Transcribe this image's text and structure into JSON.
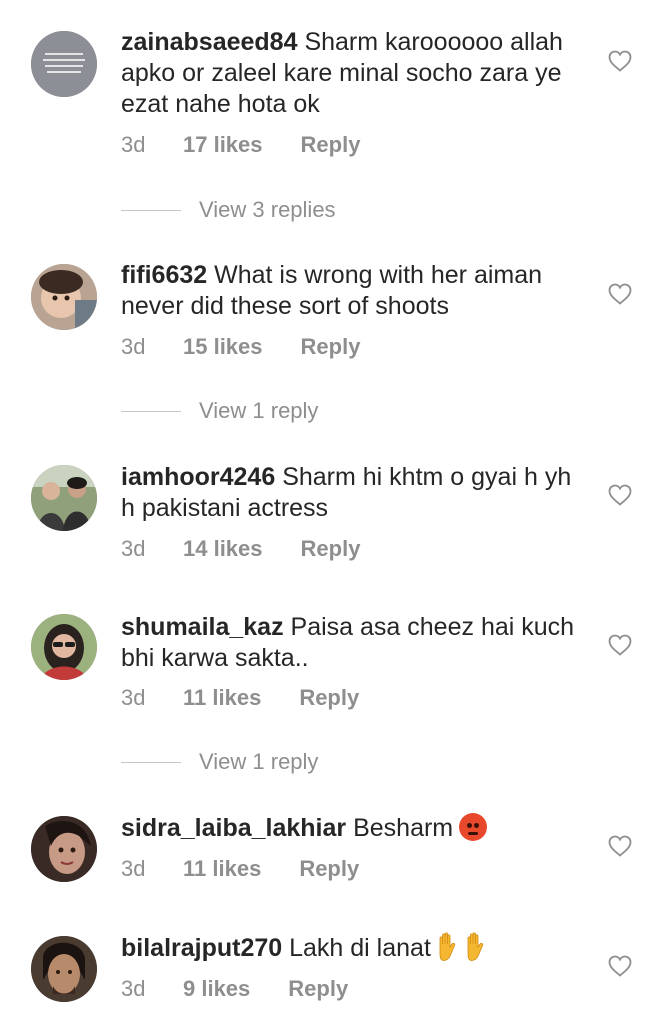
{
  "comments": [
    {
      "username": "zainabsaeed84",
      "text": "Sharm karoooooo allah apko or zaleel kare minal socho zara ye ezat nahe hota ok",
      "time": "3d",
      "likes": "17 likes",
      "reply": "Reply",
      "view_replies": "View 3 replies"
    },
    {
      "username": "fifi6632",
      "text": "What is wrong with her aiman never did these sort of shoots",
      "time": "3d",
      "likes": "15 likes",
      "reply": "Reply",
      "view_replies": "View 1 reply"
    },
    {
      "username": "iamhoor4246",
      "text": "Sharm hi khtm o gyai h yh h pakistani actress",
      "time": "3d",
      "likes": "14 likes",
      "reply": "Reply"
    },
    {
      "username": "shumaila_kaz",
      "text": "Paisa asa cheez hai kuch bhi karwa sakta..",
      "time": "3d",
      "likes": "11 likes",
      "reply": "Reply",
      "view_replies": "View 1 reply"
    },
    {
      "username": "sidra_laiba_lakhiar",
      "text": "Besharm",
      "emoji": "angry-face",
      "time": "3d",
      "likes": "11 likes",
      "reply": "Reply"
    },
    {
      "username": "bilalrajput270",
      "text": "Lakh di lanat",
      "emoji": "raised-hand x2",
      "time": "3d",
      "likes": "9 likes",
      "reply": "Reply"
    }
  ],
  "colors": {
    "text": "#262626",
    "secondary": "#8e8e8e",
    "divider": "#c7c7c7",
    "background": "#ffffff"
  },
  "icons": {
    "like": "heart-outline-icon"
  }
}
